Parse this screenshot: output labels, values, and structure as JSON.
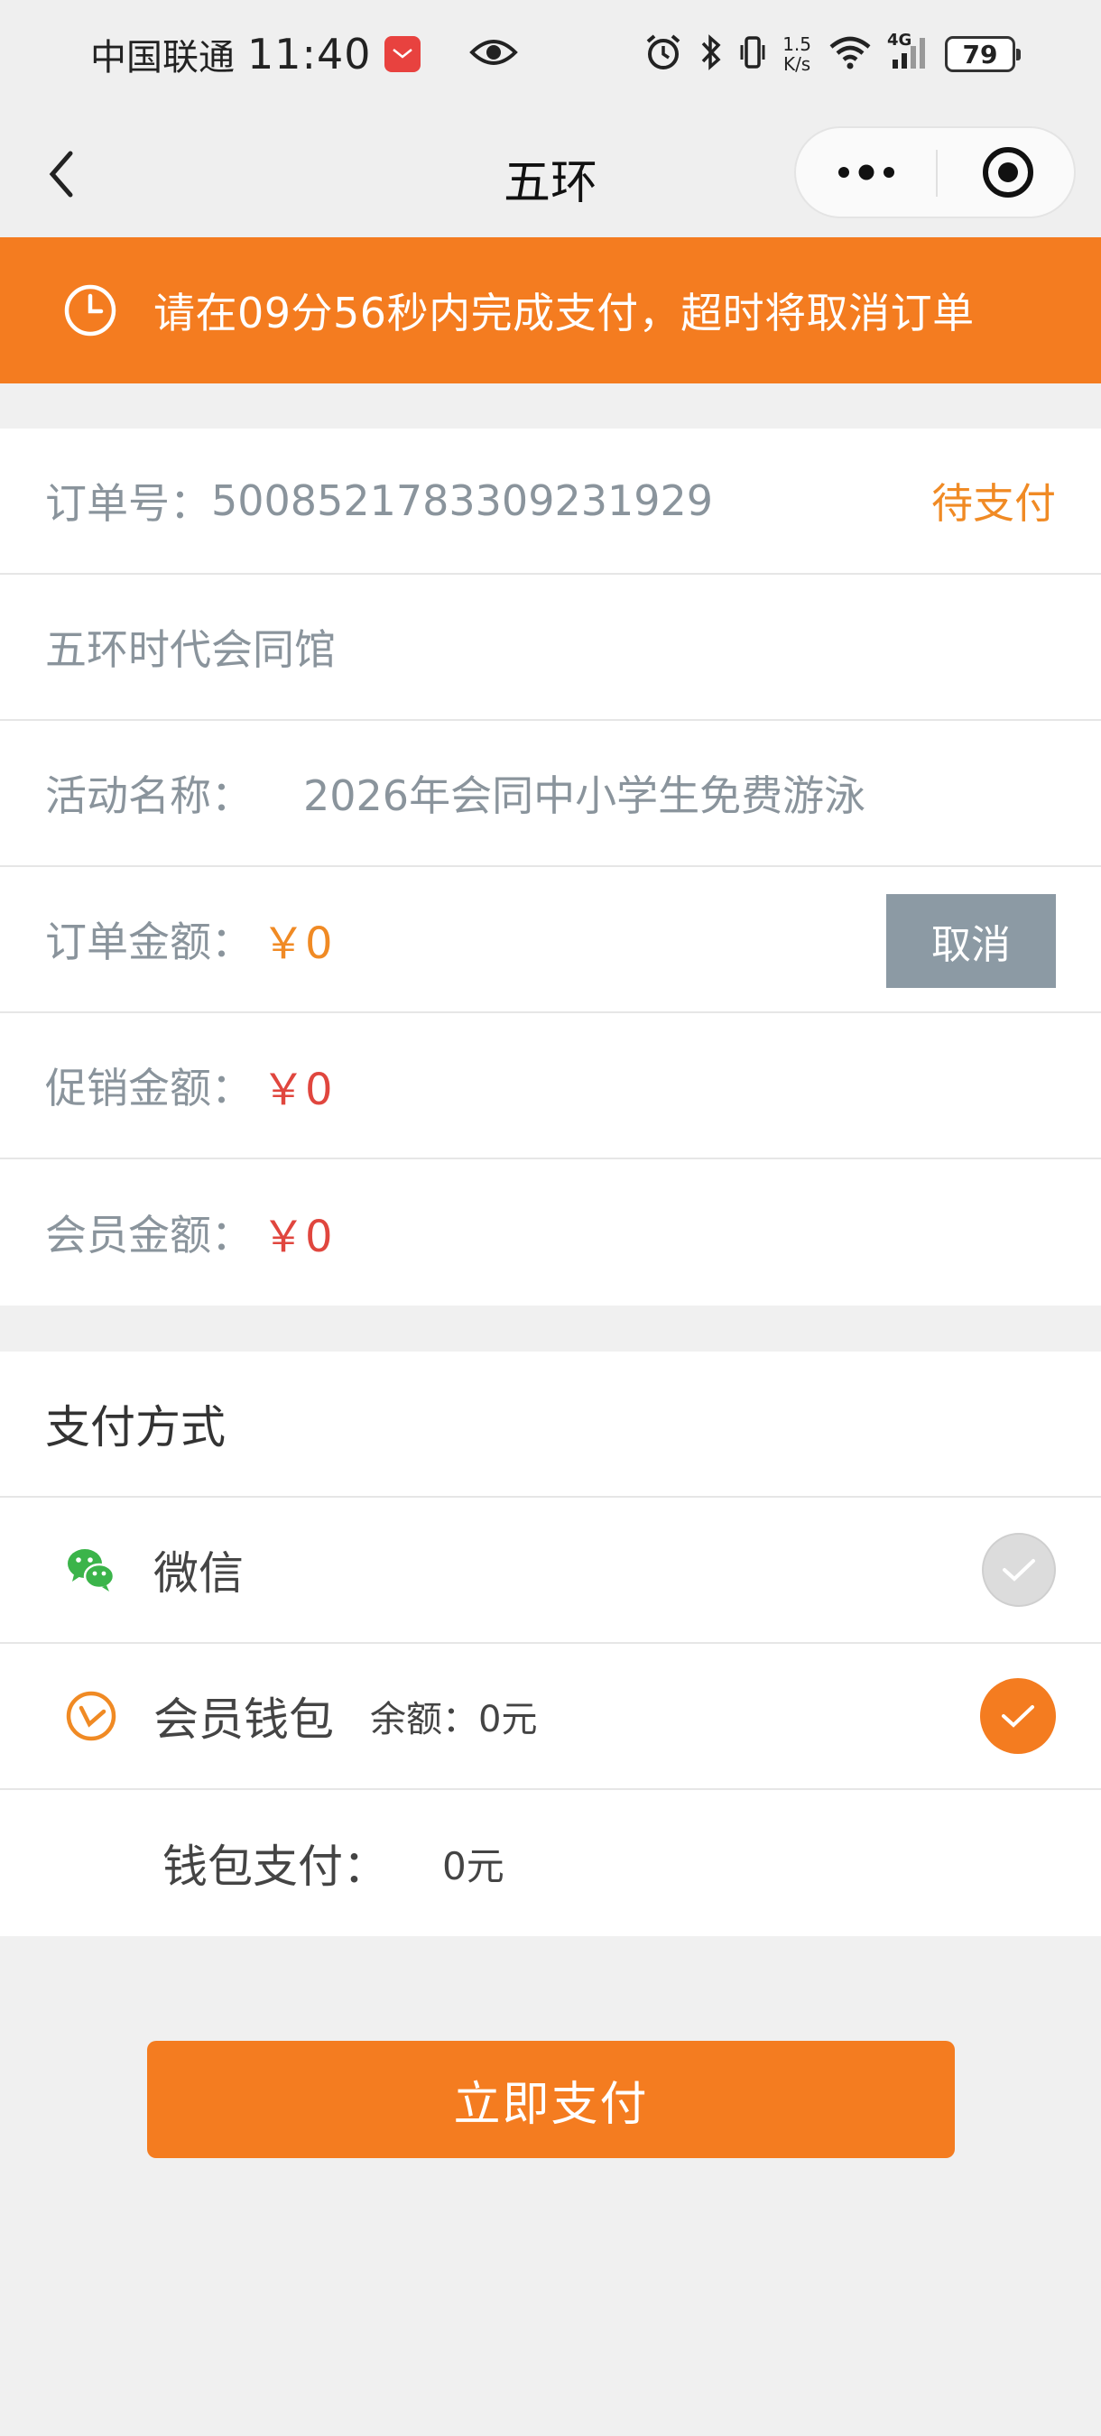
{
  "status_bar": {
    "carrier": "中国联通",
    "time": "11:40",
    "net_speed_value": "1.5",
    "net_speed_unit": "K/s",
    "network": "4G",
    "battery": "79",
    "icons": [
      "huawei-app-icon",
      "eye-icon",
      "alarm-icon",
      "bluetooth-icon",
      "vibrate-icon",
      "wifi-icon",
      "signal-icon",
      "battery-icon"
    ]
  },
  "nav": {
    "title": "五环",
    "icons": [
      "back-arrow-icon",
      "more-dots-icon",
      "target-circle-icon"
    ]
  },
  "banner": {
    "text": "请在09分56秒内完成支付，超时将取消订单",
    "icon": "clock-icon"
  },
  "order": {
    "order_no_label": "订单号：",
    "order_no": "500852178330923192​9",
    "status": "待支付",
    "venue": "五环时代会同馆",
    "activity_label": "活动名称：",
    "activity_name": "2026年会同中小学生免费游泳",
    "amount_label": "订单金额：",
    "amount": "￥0",
    "cancel_label": "取消",
    "promo_label": "促销金额：",
    "promo_amount": "￥0",
    "member_label": "会员金额：",
    "member_amount": "￥0"
  },
  "payment": {
    "title": "支付方式",
    "methods": [
      {
        "name": "微信",
        "icon": "wechat-icon",
        "selected": false
      },
      {
        "name": "会员钱包",
        "icon": "wallet-icon",
        "balance": "余额：0元",
        "selected": true
      }
    ],
    "wallet_pay_label": "钱包支付：",
    "wallet_pay_value": "0元"
  },
  "actions": {
    "pay_now_label": "立即支付"
  },
  "colors": {
    "accent_orange": "#f47c20",
    "price_red": "#e0463e",
    "wechat_green": "#3bb44a",
    "cancel_gray": "#8c9aa4"
  }
}
